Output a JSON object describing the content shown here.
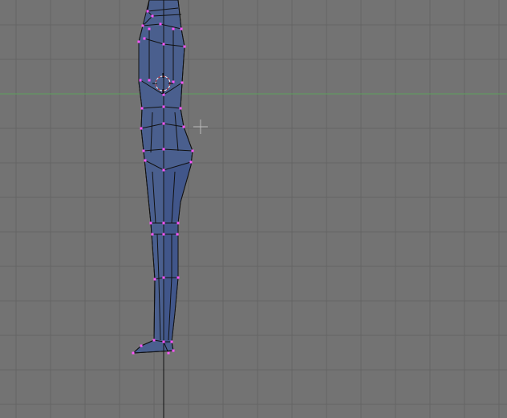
{
  "viewport": {
    "view": "side",
    "mode": "edit",
    "background_color": "#737373",
    "grid_color": "#656565",
    "x_axis_color": "#5da05d",
    "z_axis_color": "#3f3fa0",
    "mesh_fill_color": "#4a5f8e",
    "mesh_edge_color": "#111111",
    "vertex_color": "#ff55ff"
  },
  "mesh": {
    "name": "",
    "visible_part": "body-side-profile"
  },
  "icons": [
    "3d-cursor-icon",
    "crosshair-cursor-icon"
  ]
}
